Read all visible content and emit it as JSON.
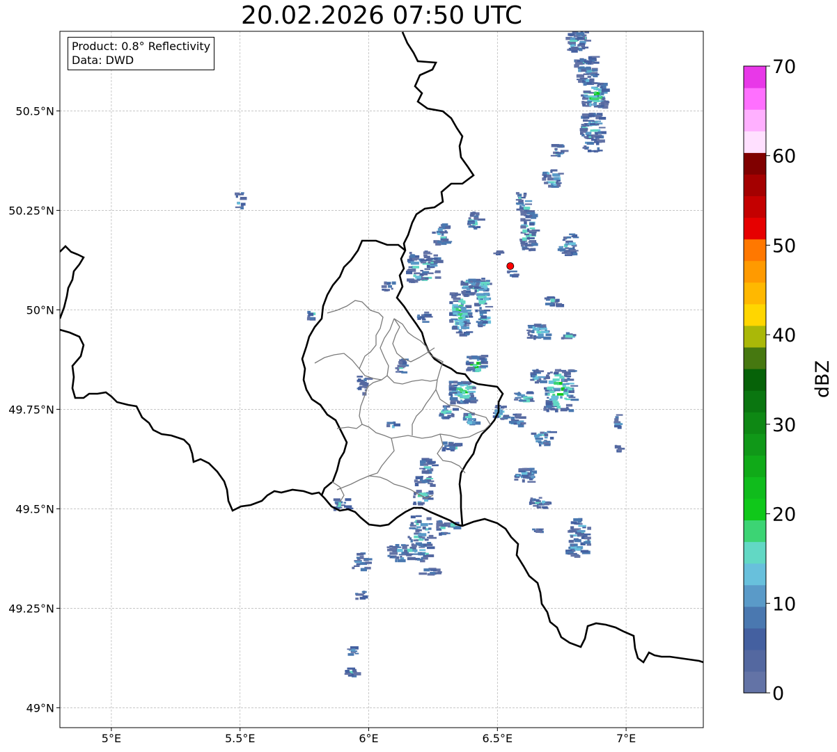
{
  "title": "20.02.2026 07:50 UTC",
  "info": {
    "product": "Product: 0.8° Reflectivity",
    "data": "Data: DWD"
  },
  "map": {
    "extent": {
      "lon": [
        4.8,
        7.3
      ],
      "lat": [
        48.95,
        50.7
      ]
    },
    "lon_ticks": [
      {
        "v": 5.0,
        "label": "5°E"
      },
      {
        "v": 5.5,
        "label": "5.5°E"
      },
      {
        "v": 6.0,
        "label": "6°E"
      },
      {
        "v": 6.5,
        "label": "6.5°E"
      },
      {
        "v": 7.0,
        "label": "7°E"
      }
    ],
    "lat_ticks": [
      {
        "v": 49.0,
        "label": "49°N"
      },
      {
        "v": 49.25,
        "label": "49.25°N"
      },
      {
        "v": 49.5,
        "label": "49.5°N"
      },
      {
        "v": 49.75,
        "label": "49.75°N"
      },
      {
        "v": 50.0,
        "label": "50°N"
      },
      {
        "v": 50.25,
        "label": "50.25°N"
      },
      {
        "v": 50.5,
        "label": "50.5°N"
      }
    ],
    "grid": true,
    "radar_site": {
      "lon": 6.55,
      "lat": 50.11,
      "color": "#ff0000"
    }
  },
  "colorbar": {
    "label": "dBZ",
    "min": 0,
    "max": 70,
    "ticks": [
      "0",
      "10",
      "20",
      "30",
      "40",
      "50",
      "60",
      "70"
    ],
    "colors": [
      "#6373a6",
      "#5468a0",
      "#4460a0",
      "#4a78b0",
      "#5a9ac8",
      "#68c0dc",
      "#62d8c4",
      "#3cd474",
      "#10c81a",
      "#10bc1c",
      "#10aa18",
      "#109818",
      "#0e8814",
      "#0a7610",
      "#066208",
      "#467810",
      "#aab808",
      "#ffd600",
      "#ffb800",
      "#ff9a00",
      "#ff7800",
      "#e60000",
      "#c40000",
      "#a40000",
      "#800000",
      "#ffe0ff",
      "#ffb0ff",
      "#ff70ff",
      "#e838e8"
    ]
  }
}
